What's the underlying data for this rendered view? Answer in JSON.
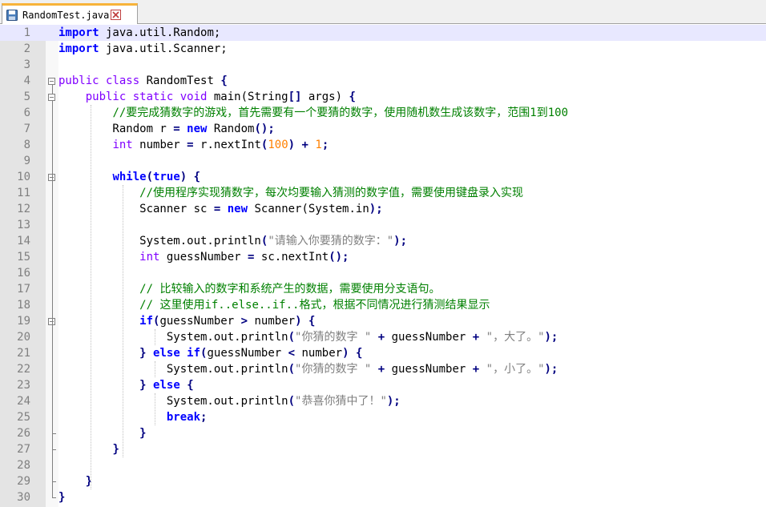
{
  "tab": {
    "filename": "RandomTest.java",
    "save_icon": "save-icon",
    "close_icon": "close-icon"
  },
  "lines": [
    {
      "n": "1",
      "tokens": [
        {
          "t": "import",
          "c": "kw"
        },
        {
          "t": " java.util.Random;"
        }
      ]
    },
    {
      "n": "2",
      "tokens": [
        {
          "t": "import",
          "c": "kw"
        },
        {
          "t": " java.util.Scanner;"
        }
      ]
    },
    {
      "n": "3",
      "tokens": []
    },
    {
      "n": "4",
      "tokens": [
        {
          "t": "public class",
          "c": "ty"
        },
        {
          "t": " RandomTest "
        },
        {
          "t": "{",
          "c": "op"
        }
      ]
    },
    {
      "n": "5",
      "tokens": [
        {
          "t": "    "
        },
        {
          "t": "public static void",
          "c": "ty"
        },
        {
          "t": " main(String"
        },
        {
          "t": "[]",
          "c": "op"
        },
        {
          "t": " args) "
        },
        {
          "t": "{",
          "c": "op"
        }
      ]
    },
    {
      "n": "6",
      "tokens": [
        {
          "t": "        "
        },
        {
          "t": "//要完成猜数字的游戏，首先需要有一个要猜的数字，使用随机数生成该数字，范围1到100",
          "c": "cm"
        }
      ]
    },
    {
      "n": "7",
      "tokens": [
        {
          "t": "        Random r "
        },
        {
          "t": "=",
          "c": "op"
        },
        {
          "t": " "
        },
        {
          "t": "new",
          "c": "kw"
        },
        {
          "t": " Random"
        },
        {
          "t": "();",
          "c": "op"
        }
      ]
    },
    {
      "n": "8",
      "tokens": [
        {
          "t": "        "
        },
        {
          "t": "int",
          "c": "ty"
        },
        {
          "t": " number "
        },
        {
          "t": "=",
          "c": "op"
        },
        {
          "t": " r.nextInt"
        },
        {
          "t": "(",
          "c": "op"
        },
        {
          "t": "100",
          "c": "num"
        },
        {
          "t": ")",
          "c": "op"
        },
        {
          "t": " "
        },
        {
          "t": "+",
          "c": "op"
        },
        {
          "t": " "
        },
        {
          "t": "1",
          "c": "num"
        },
        {
          "t": ";",
          "c": "op"
        }
      ]
    },
    {
      "n": "9",
      "tokens": []
    },
    {
      "n": "10",
      "tokens": [
        {
          "t": "        "
        },
        {
          "t": "while",
          "c": "kw"
        },
        {
          "t": "(",
          "c": "op"
        },
        {
          "t": "true",
          "c": "kw"
        },
        {
          "t": ")",
          "c": "op"
        },
        {
          "t": " "
        },
        {
          "t": "{",
          "c": "op"
        }
      ]
    },
    {
      "n": "11",
      "tokens": [
        {
          "t": "            "
        },
        {
          "t": "//使用程序实现猜数字，每次均要输入猜测的数字值，需要使用键盘录入实现",
          "c": "cm"
        }
      ]
    },
    {
      "n": "12",
      "tokens": [
        {
          "t": "            Scanner sc "
        },
        {
          "t": "=",
          "c": "op"
        },
        {
          "t": " "
        },
        {
          "t": "new",
          "c": "kw"
        },
        {
          "t": " Scanner(System.in"
        },
        {
          "t": ");",
          "c": "op"
        }
      ]
    },
    {
      "n": "13",
      "tokens": []
    },
    {
      "n": "14",
      "tokens": [
        {
          "t": "            System.out.println"
        },
        {
          "t": "(",
          "c": "op"
        },
        {
          "t": "\"请输入你要猜的数字：\"",
          "c": "str"
        },
        {
          "t": ");",
          "c": "op"
        }
      ]
    },
    {
      "n": "15",
      "tokens": [
        {
          "t": "            "
        },
        {
          "t": "int",
          "c": "ty"
        },
        {
          "t": " guessNumber "
        },
        {
          "t": "=",
          "c": "op"
        },
        {
          "t": " sc.nextInt"
        },
        {
          "t": "();",
          "c": "op"
        }
      ]
    },
    {
      "n": "16",
      "tokens": []
    },
    {
      "n": "17",
      "tokens": [
        {
          "t": "            "
        },
        {
          "t": "// 比较输入的数字和系统产生的数据，需要使用分支语句。",
          "c": "cm"
        }
      ]
    },
    {
      "n": "18",
      "tokens": [
        {
          "t": "            "
        },
        {
          "t": "// 这里使用if..else..if..格式，根据不同情况进行猜测结果显示",
          "c": "cm"
        }
      ]
    },
    {
      "n": "19",
      "tokens": [
        {
          "t": "            "
        },
        {
          "t": "if",
          "c": "kw"
        },
        {
          "t": "(",
          "c": "op"
        },
        {
          "t": "guessNumber "
        },
        {
          "t": ">",
          "c": "op"
        },
        {
          "t": " number"
        },
        {
          "t": ")",
          "c": "op"
        },
        {
          "t": " "
        },
        {
          "t": "{",
          "c": "op"
        }
      ]
    },
    {
      "n": "20",
      "tokens": [
        {
          "t": "                System.out.println"
        },
        {
          "t": "(",
          "c": "op"
        },
        {
          "t": "\"你猜的数字 \"",
          "c": "str"
        },
        {
          "t": " "
        },
        {
          "t": "+",
          "c": "op"
        },
        {
          "t": " guessNumber "
        },
        {
          "t": "+",
          "c": "op"
        },
        {
          "t": " "
        },
        {
          "t": "\"，大了。\"",
          "c": "str"
        },
        {
          "t": ");",
          "c": "op"
        }
      ]
    },
    {
      "n": "21",
      "tokens": [
        {
          "t": "            "
        },
        {
          "t": "}",
          "c": "op"
        },
        {
          "t": " "
        },
        {
          "t": "else if",
          "c": "kw"
        },
        {
          "t": "(",
          "c": "op"
        },
        {
          "t": "guessNumber "
        },
        {
          "t": "<",
          "c": "op"
        },
        {
          "t": " number"
        },
        {
          "t": ")",
          "c": "op"
        },
        {
          "t": " "
        },
        {
          "t": "{",
          "c": "op"
        }
      ]
    },
    {
      "n": "22",
      "tokens": [
        {
          "t": "                System.out.println"
        },
        {
          "t": "(",
          "c": "op"
        },
        {
          "t": "\"你猜的数字 \"",
          "c": "str"
        },
        {
          "t": " "
        },
        {
          "t": "+",
          "c": "op"
        },
        {
          "t": " guessNumber "
        },
        {
          "t": "+",
          "c": "op"
        },
        {
          "t": " "
        },
        {
          "t": "\"，小了。\"",
          "c": "str"
        },
        {
          "t": ");",
          "c": "op"
        }
      ]
    },
    {
      "n": "23",
      "tokens": [
        {
          "t": "            "
        },
        {
          "t": "}",
          "c": "op"
        },
        {
          "t": " "
        },
        {
          "t": "else",
          "c": "kw"
        },
        {
          "t": " "
        },
        {
          "t": "{",
          "c": "op"
        }
      ]
    },
    {
      "n": "24",
      "tokens": [
        {
          "t": "                System.out.println"
        },
        {
          "t": "(",
          "c": "op"
        },
        {
          "t": "\"恭喜你猜中了！\"",
          "c": "str"
        },
        {
          "t": ");",
          "c": "op"
        }
      ]
    },
    {
      "n": "25",
      "tokens": [
        {
          "t": "                "
        },
        {
          "t": "break",
          "c": "kw"
        },
        {
          "t": ";",
          "c": "op"
        }
      ]
    },
    {
      "n": "26",
      "tokens": [
        {
          "t": "            "
        },
        {
          "t": "}",
          "c": "op"
        }
      ]
    },
    {
      "n": "27",
      "tokens": [
        {
          "t": "        "
        },
        {
          "t": "}",
          "c": "op"
        }
      ]
    },
    {
      "n": "28",
      "tokens": []
    },
    {
      "n": "29",
      "tokens": [
        {
          "t": "    "
        },
        {
          "t": "}",
          "c": "op"
        }
      ]
    },
    {
      "n": "30",
      "tokens": [
        {
          "t": "}",
          "c": "op"
        }
      ]
    }
  ],
  "current_line": "1",
  "colors": {
    "keyword": "#0000ff",
    "type": "#8000ff",
    "number": "#ff8000",
    "string": "#808080",
    "comment": "#008000",
    "current_line": "#e8e8ff",
    "tab_accent": "#f7b33a"
  }
}
